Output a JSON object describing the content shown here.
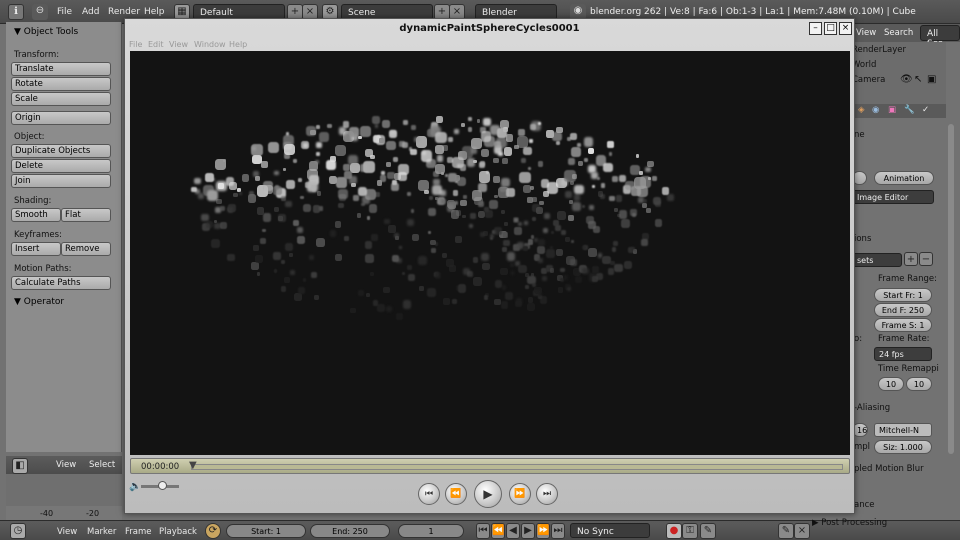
{
  "topbar": {
    "menus": [
      "File",
      "Add",
      "Render",
      "Help"
    ],
    "screen_layout": "Default",
    "scene": "Scene",
    "render_engine": "Blender Render",
    "stats": "blender.org 262 | Ve:8 | Fa:6 | Ob:1-3 | La:1 | Mem:7.48M (0.10M) | Cube"
  },
  "tools": {
    "title": "Object Tools",
    "transform_label": "Transform:",
    "translate": "Translate",
    "rotate": "Rotate",
    "scale": "Scale",
    "origin": "Origin",
    "object_label": "Object:",
    "duplicate": "Duplicate Objects",
    "delete": "Delete",
    "join": "Join",
    "shading_label": "Shading:",
    "smooth": "Smooth",
    "flat": "Flat",
    "keyframes_label": "Keyframes:",
    "insert": "Insert",
    "remove": "Remove",
    "motion_label": "Motion Paths:",
    "calc_paths": "Calculate Paths",
    "operator": "Operator"
  },
  "timeline_header": {
    "view": "View",
    "select": "Select",
    "tick_a": "-40",
    "tick_b": "-20"
  },
  "bottombar": {
    "view": "View",
    "marker": "Marker",
    "frame": "Frame",
    "playback": "Playback",
    "start": "Start: 1",
    "end": "End: 250",
    "current": "1",
    "sync": "No Sync"
  },
  "right_panel": {
    "tabs": [
      "View",
      "Search",
      "All Sce"
    ],
    "outliner": [
      "RenderLayer",
      "World",
      "Camera"
    ],
    "ne_text": "ne",
    "animation": "Animation",
    "image_editor": "Image Editor",
    "dimensions": "ions",
    "presets": "sets",
    "frame_range": "Frame Range:",
    "start_fr": "Start Fr: 1",
    "end_f": "End F: 250",
    "frame_s": "Frame S: 1",
    "o_label": "o:",
    "frame_rate": "Frame Rate:",
    "fps": "24 fps",
    "time_remap": "Time Remappi",
    "remap_a": "10",
    "remap_b": "10",
    "aliasing": "-Aliasing",
    "aa_num": "16",
    "filter": "Mitchell-N",
    "mpl": "mpl",
    "size": "Siz: 1.000",
    "motion_blur": "pled Motion Blur",
    "ance": "ance",
    "post_processing": "Post Processing"
  },
  "player": {
    "title": "dynamicPaintSphereCycles0001",
    "menus": [
      "File",
      "Edit",
      "View",
      "Window",
      "Help"
    ],
    "time": "00:00:00",
    "progress": 0.0,
    "volume": 0.45
  }
}
